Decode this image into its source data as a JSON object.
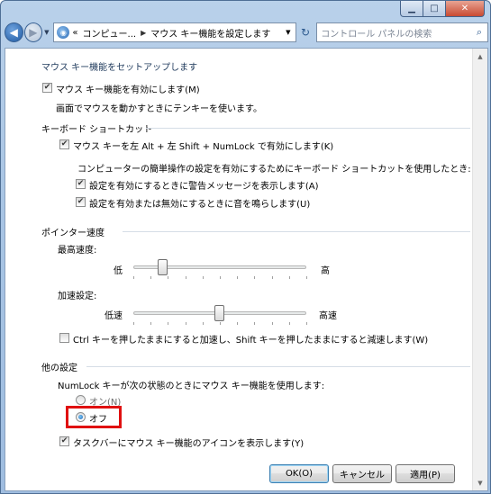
{
  "window": {
    "caption_buttons": {
      "minimize_icon": "minimize-icon",
      "maximize_icon": "maximize-icon",
      "close_icon": "close-icon"
    }
  },
  "nav": {
    "back_glyph": "◀",
    "forward_glyph": "▶",
    "history_glyph": "▼",
    "address": {
      "prefix": "«",
      "crumbs": [
        "コンピュー...",
        "マウス キー機能を設定します"
      ],
      "separator": "▶",
      "dropdown_glyph": "▼"
    },
    "refresh_glyph": "↻",
    "search": {
      "placeholder": "コントロール パネルの検索",
      "icon_glyph": "⌕"
    }
  },
  "page": {
    "title": "マウス キー機能をセットアップします",
    "enable_mousekeys": {
      "label": "マウス キー機能を有効にします(M)",
      "checked": true
    },
    "enable_desc": "画面でマウスを動かすときにテンキーを使います。",
    "keyboard_shortcut": {
      "group": "キーボード ショートカット",
      "shortcut": {
        "label": "マウス キーを左 Alt + 左 Shift + NumLock で有効にします(K)",
        "checked": true
      },
      "desc": "コンピューターの簡単操作の設定を有効にするためにキーボード ショートカットを使用したとき:",
      "warn": {
        "label": "設定を有効にするときに警告メッセージを表示します(A)",
        "checked": true
      },
      "sound": {
        "label": "設定を有効または無効にするときに音を鳴らします(U)",
        "checked": true
      }
    },
    "pointer_speed": {
      "group": "ポインター速度",
      "top_speed": {
        "label": "最高速度:",
        "low": "低",
        "high": "高",
        "value_fraction": 0.17
      },
      "acceleration": {
        "label": "加速設定:",
        "low": "低速",
        "high": "高速",
        "value_fraction": 0.5
      },
      "ctrl_shift": {
        "label": "Ctrl キーを押したままにすると加速し、Shift キーを押したままにすると減速します(W)",
        "checked": false
      }
    },
    "other": {
      "group": "他の設定",
      "numlock_desc": "NumLock キーが次の状態のときにマウス キー機能を使用します:",
      "on": {
        "label": "オン(N)",
        "selected": false
      },
      "off": {
        "label": "オフ",
        "selected": true
      },
      "taskbar_icon": {
        "label": "タスクバーにマウス キー機能のアイコンを表示します(Y)",
        "checked": true
      }
    }
  },
  "buttons": {
    "ok": "OK(O)",
    "cancel": "キャンセル",
    "apply": "適用(P)"
  },
  "colors": {
    "highlight": "#e01010",
    "heading": "#1e395b"
  }
}
